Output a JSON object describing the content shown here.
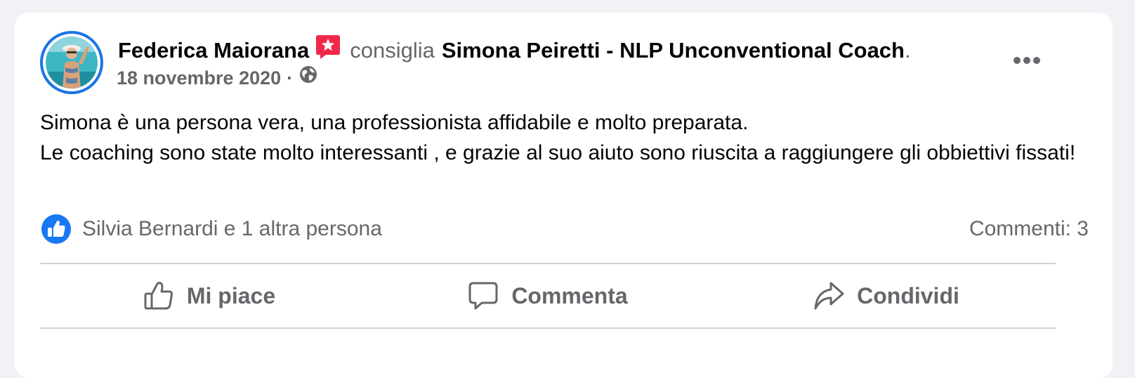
{
  "post": {
    "author": "Federica Maiorana",
    "verb": "consiglia",
    "page_name": "Simona Peiretti - NLP Unconventional Coach",
    "period": ".",
    "date": "18 novembre 2020",
    "separator": "·",
    "privacy_icon": "globe-icon",
    "recommendation_icon": "recommendation-badge-icon",
    "body": [
      "Simona è una persona vera, una professionista affidabile e molto preparata.",
      "Le coaching sono state molto interessanti , e grazie al suo aiuto sono riuscita a raggiungere gli obbiettivi fissati!"
    ]
  },
  "reactions": {
    "summary": "Silvia Bernardi e 1 altra persona",
    "comments": "Commenti: 3"
  },
  "actions": {
    "like": "Mi piace",
    "comment": "Commenta",
    "share": "Condividi"
  },
  "colors": {
    "accent": "#1b74e4",
    "recommend_badge": "#f02849",
    "secondary_text": "#65676b",
    "primary_text": "#050505"
  }
}
